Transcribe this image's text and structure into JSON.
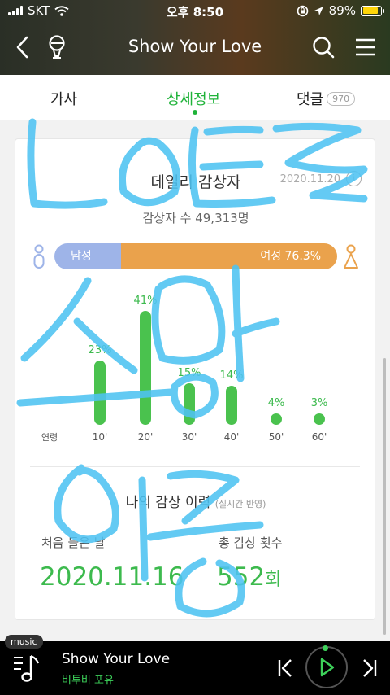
{
  "status_bar": {
    "carrier": "SKT",
    "time": "오후 8:50",
    "battery": "89%",
    "battery_level": 0.89
  },
  "header": {
    "title": "Show Your Love"
  },
  "tabs": [
    {
      "label": "가사",
      "active": false
    },
    {
      "label": "상세정보",
      "active": true
    },
    {
      "label": "댓글",
      "count": "970",
      "active": false
    }
  ],
  "daily": {
    "title": "데일리 감상자",
    "date": "2020.11.20",
    "info_icon": "i",
    "viewers": "감상자 수 49,313명",
    "gender": {
      "male_label": "남성 23.7%",
      "female_label": "여성 76.3%",
      "male_fraction": 0.237,
      "male_color": "#9eb4e8",
      "female_color": "#eaa24c"
    },
    "age_axis_label": "연령",
    "ages": [
      {
        "label": "10'",
        "pct": "23%",
        "value": 23
      },
      {
        "label": "20'",
        "pct": "41%",
        "value": 41
      },
      {
        "label": "30'",
        "pct": "15%",
        "value": 15
      },
      {
        "label": "40'",
        "pct": "14%",
        "value": 14
      },
      {
        "label": "50'",
        "pct": "4%",
        "value": 4
      },
      {
        "label": "60'",
        "pct": "3%",
        "value": 3
      }
    ]
  },
  "history": {
    "title": "나의 감상 이력",
    "note": "(실시간 반영)",
    "first_label": "처음 들은 날",
    "first_value": "2020.11.16",
    "count_label": "총 감상 횟수",
    "count_value": "552",
    "count_unit": "회"
  },
  "player": {
    "tag": "music",
    "title": "Show Your Love",
    "artist": "비투비 포유"
  },
  "colors": {
    "accent_green": "#1fb339",
    "bar_green": "#4ac24e",
    "scribble": "#4ec3f2"
  }
}
